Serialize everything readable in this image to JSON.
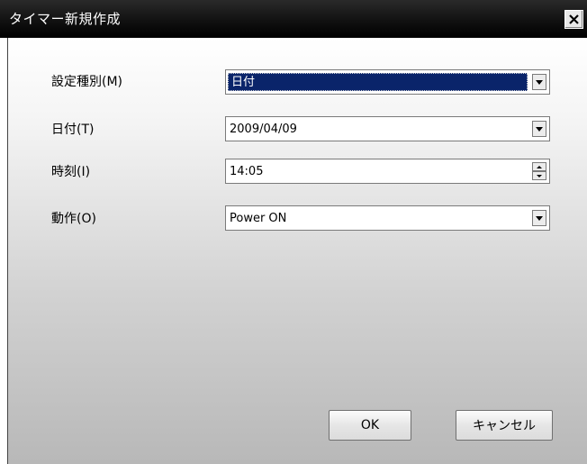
{
  "window": {
    "title": "タイマー新規作成",
    "close_symbol": "✕"
  },
  "form": {
    "setting_type": {
      "label": "設定種別(M)",
      "value": "日付"
    },
    "date": {
      "label": "日付(T)",
      "value": "2009/04/09"
    },
    "time": {
      "label": "時刻(I)",
      "value": "14:05"
    },
    "action": {
      "label": "動作(O)",
      "value": "Power ON"
    }
  },
  "buttons": {
    "ok": "OK",
    "cancel": "キャンセル"
  },
  "colors": {
    "titlebar": "#000000",
    "selection": "#0a246a"
  },
  "icons": [
    "close-icon",
    "dropdown-arrow-icon",
    "spin-up-icon",
    "spin-down-icon"
  ]
}
